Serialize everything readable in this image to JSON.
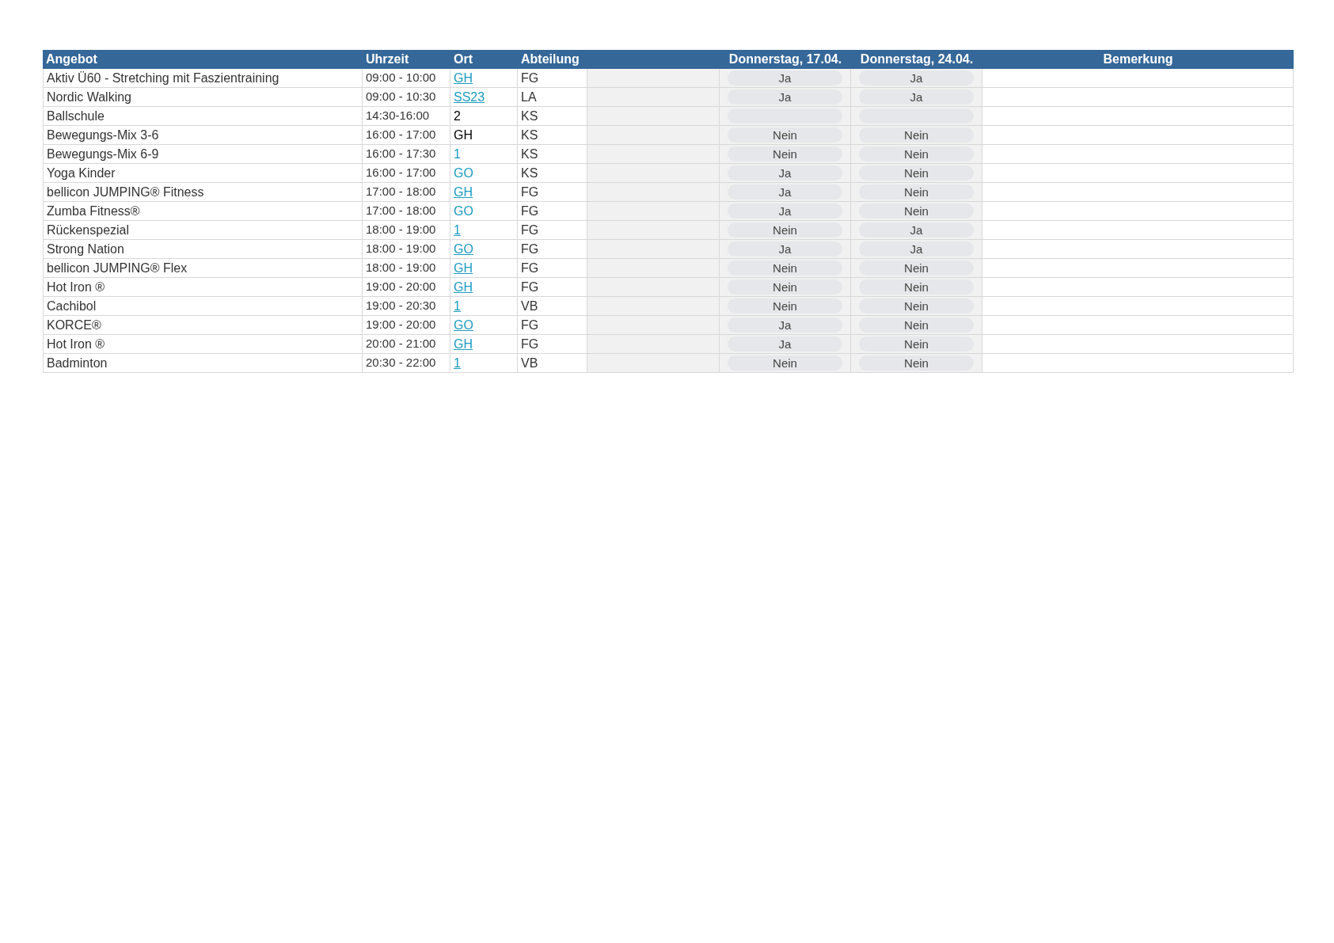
{
  "table": {
    "columns": [
      "Angebot",
      "Uhrzeit",
      "Ort",
      "Abteilung",
      "Donnerstag, 17.04.",
      "Donnerstag, 24.04.",
      "Bemerkung"
    ],
    "rows": [
      {
        "angebot": "Aktiv Ü60 - Stretching mit Faszientraining",
        "uhrzeit": "09:00 - 10:00",
        "ort": {
          "text": "GH",
          "kind": "link"
        },
        "abteilung": "FG",
        "day_1": "Ja",
        "day_2": "Ja"
      },
      {
        "angebot": "Nordic Walking",
        "uhrzeit": "09:00 - 10:30",
        "ort": {
          "text": "SS23",
          "kind": "link"
        },
        "abteilung": "LA",
        "day_1": "Ja",
        "day_2": "Ja"
      },
      {
        "angebot": "Ballschule",
        "uhrzeit": "14:30-16:00",
        "ort": {
          "text": "2",
          "kind": "plain"
        },
        "abteilung": "KS"
      },
      {
        "angebot": "Bewegungs-Mix 3-6",
        "uhrzeit": "16:00 - 17:00",
        "ort": {
          "text": "GH",
          "kind": "plain"
        },
        "abteilung": "KS",
        "day_1": "Nein",
        "day_2": "Nein"
      },
      {
        "angebot": "Bewegungs-Mix 6-9",
        "uhrzeit": "16:00 - 17:30",
        "ort": {
          "text": "1",
          "kind": "colored"
        },
        "abteilung": "KS",
        "day_1": "Nein",
        "day_2": "Nein"
      },
      {
        "angebot": "Yoga Kinder",
        "uhrzeit": "16:00 - 17:00",
        "ort": {
          "text": "GO",
          "kind": "colored"
        },
        "abteilung": "KS",
        "day_1": "Ja",
        "day_2": "Nein"
      },
      {
        "angebot": "bellicon JUMPING® Fitness",
        "uhrzeit": "17:00 - 18:00",
        "ort": {
          "text": "GH",
          "kind": "link"
        },
        "abteilung": "FG",
        "day_1": "Ja",
        "day_2": "Nein"
      },
      {
        "angebot": "Zumba Fitness®",
        "uhrzeit": "17:00 - 18:00",
        "ort": {
          "text": "GO",
          "kind": "colored"
        },
        "abteilung": "FG",
        "day_1": "Ja",
        "day_2": "Nein"
      },
      {
        "angebot": "Rückenspezial",
        "uhrzeit": "18:00 - 19:00",
        "ort": {
          "text": "1",
          "kind": "link"
        },
        "abteilung": "FG",
        "day_1": "Nein",
        "day_2": "Ja"
      },
      {
        "angebot": "Strong Nation",
        "uhrzeit": "18:00 - 19:00",
        "ort": {
          "text": "GO",
          "kind": "link"
        },
        "abteilung": "FG",
        "day_1": "Ja",
        "day_2": "Ja"
      },
      {
        "angebot": "bellicon JUMPING® Flex",
        "uhrzeit": "18:00 - 19:00",
        "ort": {
          "text": "GH",
          "kind": "link"
        },
        "abteilung": "FG",
        "day_1": "Nein",
        "day_2": "Nein"
      },
      {
        "angebot": "Hot Iron ®",
        "uhrzeit": "19:00 - 20:00",
        "ort": {
          "text": "GH",
          "kind": "link"
        },
        "abteilung": "FG",
        "day_1": "Nein",
        "day_2": "Nein"
      },
      {
        "angebot": "Cachibol",
        "uhrzeit": "19:00 - 20:30",
        "ort": {
          "text": "1",
          "kind": "link"
        },
        "abteilung": "VB",
        "day_1": "Nein",
        "day_2": "Nein"
      },
      {
        "angebot": "KORCE®",
        "uhrzeit": "19:00 - 20:00",
        "ort": {
          "text": "GO",
          "kind": "link"
        },
        "abteilung": "FG",
        "day_1": "Ja",
        "day_2": "Nein"
      },
      {
        "angebot": "Hot Iron ®",
        "uhrzeit": "20:00 - 21:00",
        "ort": {
          "text": "GH",
          "kind": "link"
        },
        "abteilung": "FG",
        "day_1": "Ja",
        "day_2": "Nein"
      },
      {
        "angebot": "Badminton",
        "uhrzeit": "20:30 - 22:00",
        "ort": {
          "text": "1",
          "kind": "link"
        },
        "abteilung": "VB",
        "day_1": "Nein",
        "day_2": "Nein"
      }
    ]
  }
}
